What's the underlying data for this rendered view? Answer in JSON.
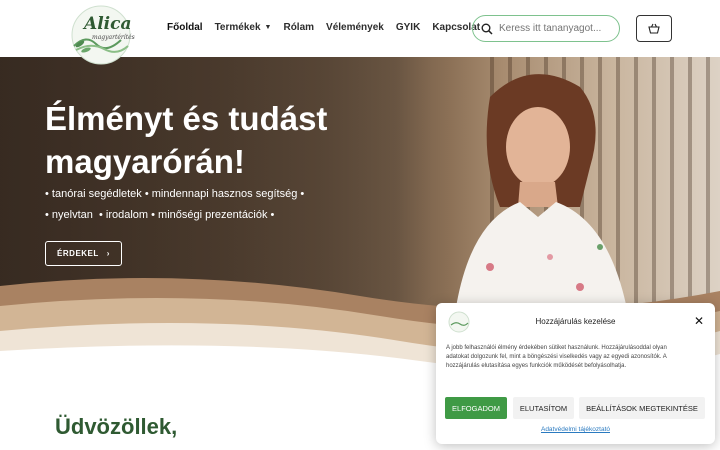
{
  "header": {
    "logo": {
      "name": "Alica",
      "subtitle": "magyartérítés"
    },
    "nav": [
      {
        "label": "Főoldal",
        "active": true
      },
      {
        "label": "Termékek",
        "has_dropdown": true
      },
      {
        "label": "Rólam"
      },
      {
        "label": "Vélemények"
      },
      {
        "label": "GYIK"
      },
      {
        "label": "Kapcsolat"
      }
    ],
    "search": {
      "placeholder": "Keress itt tananyagot...",
      "icon": "search-icon"
    },
    "cart": {
      "icon": "basket-icon"
    }
  },
  "hero": {
    "title_line1": "Élményt és tudást",
    "title_line2": "magyarórán!",
    "line1": "• tanórai segédletek • mindennapi hasznos segítség •",
    "line2": "• nyelvtan  • irodalom • minőségi prezentációk •",
    "button_label": "ÉRDEKEL"
  },
  "welcome": {
    "heading": "Üdvözöllek,"
  },
  "consent": {
    "title": "Hozzájárulás kezelése",
    "text": "A jobb felhasználói élmény érdekében sütiket használunk. Hozzájárulásoddal olyan adatokat dolgozunk fel, mint a böngészési viselkedés vagy az egyedi azonosítók. A hozzájárulás elutasítása egyes funkciók működését befolyásolhatja.",
    "accept_label": "ELFOGADOM",
    "deny_label": "ELUTASÍTOM",
    "settings_label": "BEÁLLÍTÁSOK MEGTEKINTÉSE",
    "link_label": "Adatvédelmi tájékoztató"
  },
  "colors": {
    "brand_green": "#2f5a32",
    "accept_green": "#3f9a45",
    "search_border": "#7ec28e",
    "link_blue": "#2a7ac0"
  }
}
